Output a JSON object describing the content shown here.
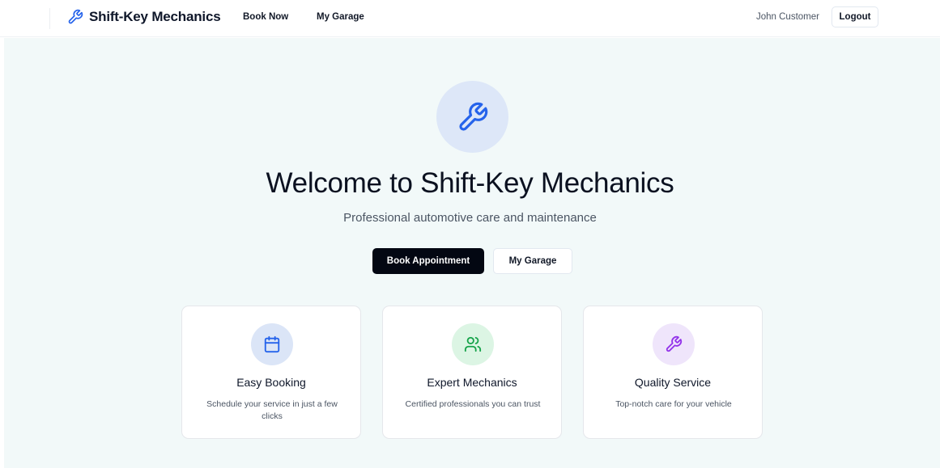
{
  "nav": {
    "brand": "Shift-Key Mechanics",
    "brand_icon": "wrench-icon",
    "links": [
      "Book Now",
      "My Garage"
    ],
    "user": "John Customer",
    "logout_label": "Logout"
  },
  "hero": {
    "icon": "wrench-icon",
    "title": "Welcome to Shift-Key Mechanics",
    "subtitle": "Professional automotive care and maintenance",
    "primary_button": "Book Appointment",
    "secondary_button": "My Garage"
  },
  "features": [
    {
      "icon": "calendar-icon",
      "title": "Easy Booking",
      "description": "Schedule your service in just a few clicks",
      "icon_color": "#2563eb",
      "icon_bg": "#dbe5f7"
    },
    {
      "icon": "users-icon",
      "title": "Expert Mechanics",
      "description": "Certified professionals you can trust",
      "icon_color": "#16a34a",
      "icon_bg": "#dcf5e4"
    },
    {
      "icon": "wrench-icon",
      "title": "Quality Service",
      "description": "Top-notch care for your vehicle",
      "icon_color": "#9333ea",
      "icon_bg": "#efe5fb"
    }
  ],
  "colors": {
    "accent": "#2563eb",
    "hero_background": "#f2f9f9",
    "primary_button": "#030712"
  }
}
